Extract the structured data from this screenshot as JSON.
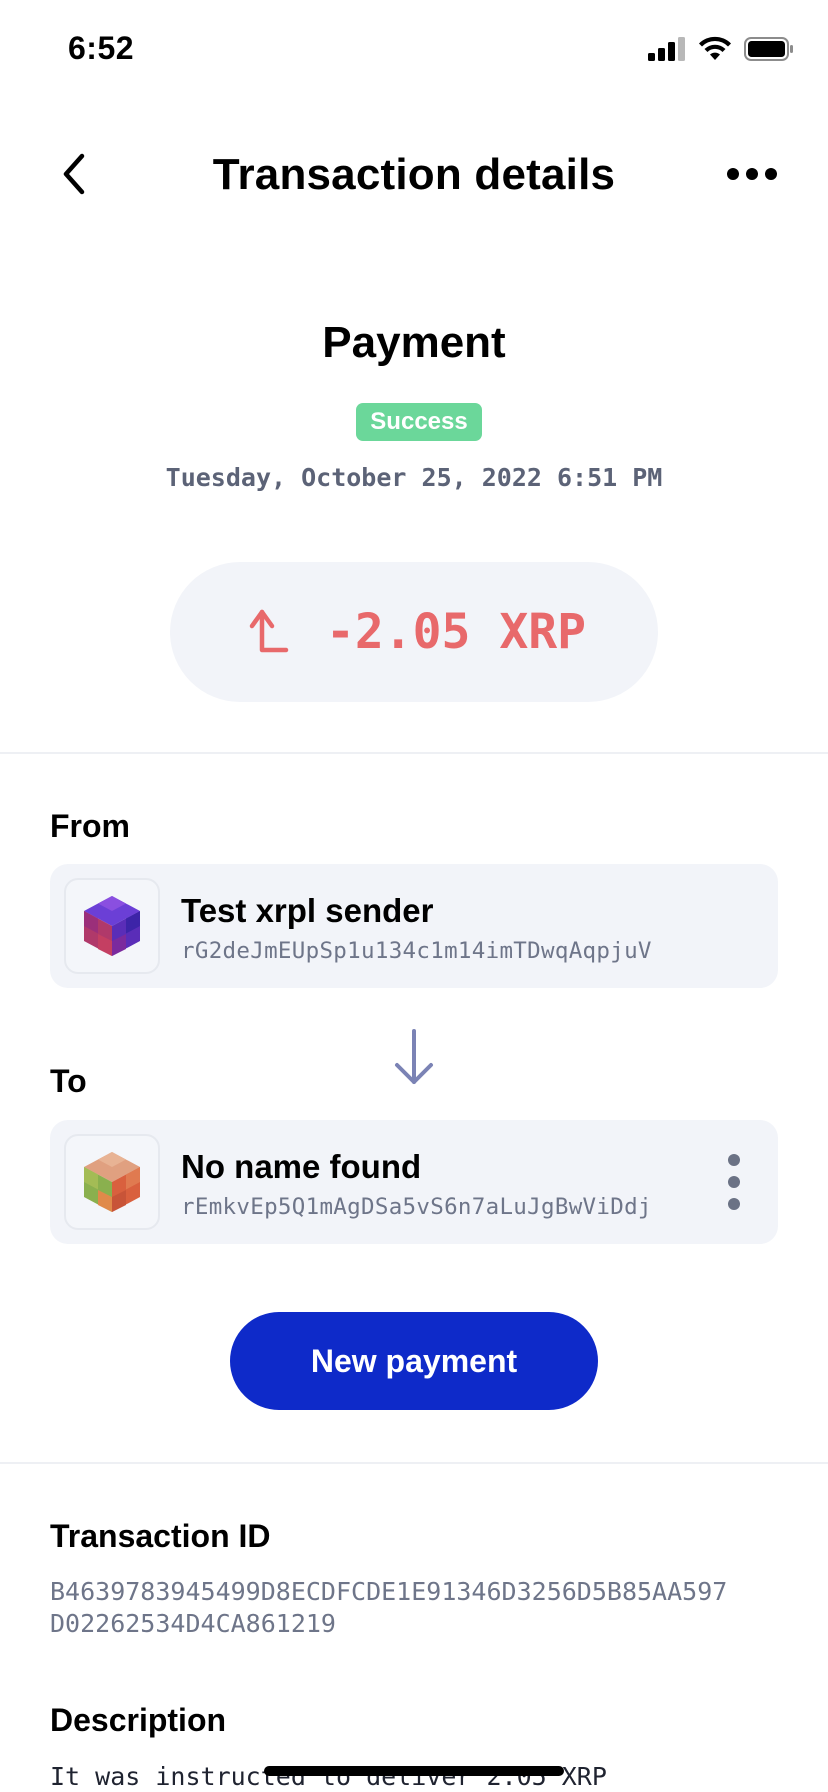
{
  "status_bar": {
    "time": "6:52"
  },
  "header": {
    "title": "Transaction details"
  },
  "summary": {
    "type": "Payment",
    "status": "Success",
    "date": "Tuesday, October 25, 2022 6:51 PM",
    "amount": "-2.05 XRP"
  },
  "from": {
    "label": "From",
    "name": "Test xrpl sender",
    "address": "rG2deJmEUpSp1u134c1m14imTDwqAqpjuV"
  },
  "to": {
    "label": "To",
    "name": "No name found",
    "address": "rEmkvEp5Q1mAgDSa5vS6n7aLuJgBwViDdj"
  },
  "actions": {
    "new_payment": "New payment"
  },
  "details": {
    "tx_id_label": "Transaction ID",
    "tx_id_line1": "B4639783945499D8ECDFCDE1E91346D3256D5B85AA597",
    "tx_id_line2": "D02262534D4CA861219",
    "description_label": "Description",
    "description": "It was instructed to deliver 2.05 XRP"
  },
  "colors": {
    "success": "#6bd79a",
    "amount_negative": "#e8696b",
    "primary_button": "#0e2ac9",
    "card_bg": "#f2f4f9"
  },
  "icons": {
    "back": "chevron-left-icon",
    "more": "more-horizontal-icon",
    "outgoing": "arrow-up-outgoing-icon",
    "flow": "arrow-down-icon"
  }
}
